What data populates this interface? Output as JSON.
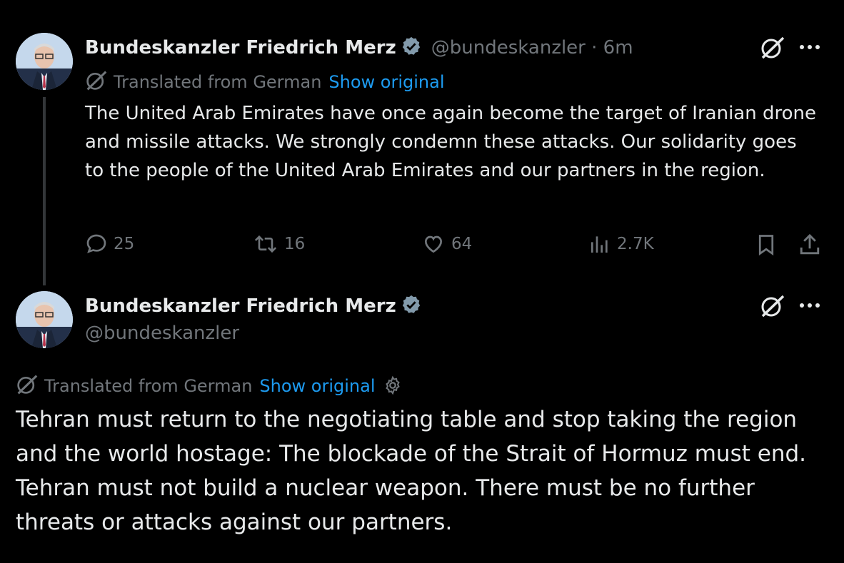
{
  "colors": {
    "background": "#000000",
    "text": "#e7e9ea",
    "muted": "#71767b",
    "link": "#1d9bf0",
    "verified_badge": "#829aab"
  },
  "post1": {
    "author_name": "Bundeskanzler Friedrich Merz",
    "handle_time": "@bundeskanzler · 6m",
    "translated_label": "Translated from German",
    "show_original": "Show original",
    "text": "The United Arab Emirates have once again become the target of Iranian drone and missile attacks. We strongly condemn these attacks. Our solidarity goes to the people of the United Arab Emirates and our partners in the region.",
    "replies": "25",
    "reposts": "16",
    "likes": "64",
    "views": "2.7K",
    "icons": [
      "grok-icon",
      "more-icon",
      "translate-icon",
      "reply-icon",
      "repost-icon",
      "like-icon",
      "views-icon",
      "bookmark-icon",
      "share-icon"
    ]
  },
  "post2": {
    "author_name": "Bundeskanzler Friedrich Merz",
    "handle": "@bundeskanzler",
    "translated_label": "Translated from German",
    "show_original": "Show original",
    "text": "Tehran must return to the negotiating table and stop taking the region and the world hostage: The blockade of the Strait of Hormuz must end. Tehran must not build a nuclear weapon. There must be no further threats or attacks against our partners.",
    "icons": [
      "grok-icon",
      "more-icon",
      "translate-icon",
      "settings-icon"
    ]
  }
}
